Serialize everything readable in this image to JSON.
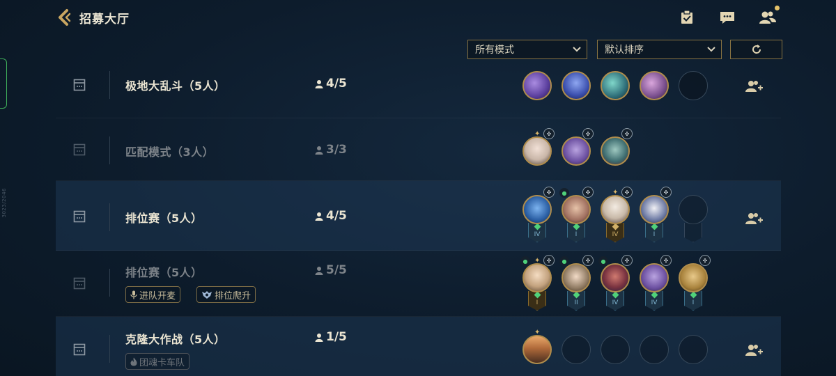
{
  "header": {
    "title": "招募大厅",
    "icons": [
      "back-arrow-icon",
      "clipboard-check-icon",
      "chat-icon",
      "friends-icon"
    ]
  },
  "filters": {
    "mode_select": "所有模式",
    "sort_select": "默认排序",
    "refresh_icon": "refresh-icon"
  },
  "side_label": "3023/2046",
  "rooms": [
    {
      "title": "极地大乱斗（5人）",
      "count": "4/5",
      "tags": [],
      "avatars": [
        {
          "color": "#5b3f9e"
        },
        {
          "color": "#3b4fae"
        },
        {
          "color": "#2f6f7a"
        },
        {
          "color": "#7a4f8e"
        },
        {
          "empty": true
        }
      ]
    },
    {
      "title": "匹配模式（3人）",
      "count": "3/3",
      "tags": [],
      "avatars": [
        {
          "color": "#c9b6a8"
        },
        {
          "color": "#6b4fa0"
        },
        {
          "color": "#3c6b6e"
        }
      ]
    },
    {
      "title": "排位赛（5人）",
      "count": "4/5",
      "tags": [],
      "avatars": [
        {
          "color": "#2b5fa4",
          "rank": "IV"
        },
        {
          "color": "#a07060",
          "rank": "I"
        },
        {
          "color": "#c8b9a8",
          "rank": "IV",
          "gold": true
        },
        {
          "color": "#6d7aa4",
          "rank": "I"
        },
        {
          "empty": true
        }
      ]
    },
    {
      "title": "排位赛（5人）",
      "count": "5/5",
      "tags": [
        "进队开麦",
        "排位爬升"
      ],
      "avatars": [
        {
          "color": "#c3a27e",
          "rank": "I",
          "gold": true
        },
        {
          "color": "#8f7a62",
          "rank": "II"
        },
        {
          "color": "#7a3340",
          "rank": "IV"
        },
        {
          "color": "#6b4fa0",
          "rank": "IV"
        },
        {
          "color": "#a8823c",
          "rank": "I"
        }
      ]
    },
    {
      "title": "克隆大作战（5人）",
      "count": "1/5",
      "tags": [
        "团魂卡车队"
      ],
      "avatars": [
        {
          "color": "#b06a3a"
        },
        {
          "empty": true
        },
        {
          "empty": true
        },
        {
          "empty": true
        },
        {
          "empty": true
        }
      ]
    }
  ]
}
